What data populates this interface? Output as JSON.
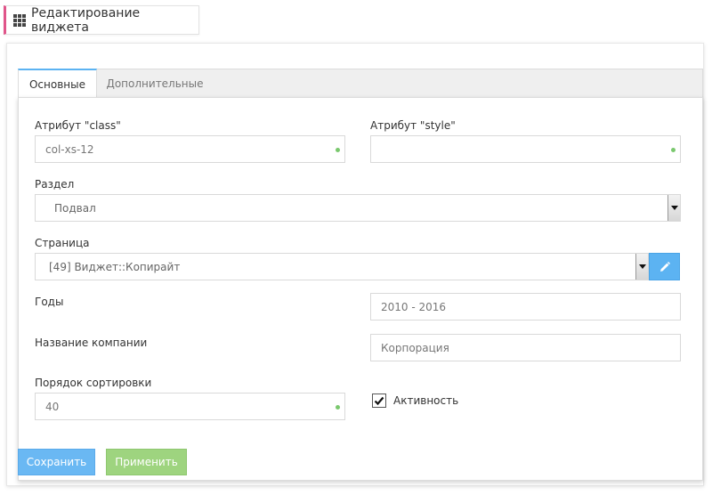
{
  "header": {
    "title": "Редактирование виджета",
    "icon": "grid-icon"
  },
  "tabs": [
    {
      "label": "Основные",
      "active": true
    },
    {
      "label": "Дополнительные",
      "active": false
    }
  ],
  "form": {
    "class_attr": {
      "label": "Атрибут \"class\"",
      "value": "col-xs-12"
    },
    "style_attr": {
      "label": "Атрибут \"style\"",
      "value": ""
    },
    "section": {
      "label": "Раздел",
      "value": "Подвал"
    },
    "page": {
      "label": "Страница",
      "value": "[49] Виджет::Копирайт"
    },
    "years": {
      "label": "Годы",
      "value": "2010 - 2016"
    },
    "company": {
      "label": "Название компании",
      "value": "Корпорация"
    },
    "sort_order": {
      "label": "Порядок сортировки",
      "value": "40"
    },
    "active": {
      "label": "Активность",
      "checked": true
    }
  },
  "buttons": {
    "save": "Сохранить",
    "apply": "Применить"
  },
  "colors": {
    "accent_blue": "#5cb3f2",
    "save_button": "#6ab8f3",
    "apply_button": "#9ed47f",
    "header_accent": "#e0558a",
    "valid_dot": "#7ac86e"
  }
}
